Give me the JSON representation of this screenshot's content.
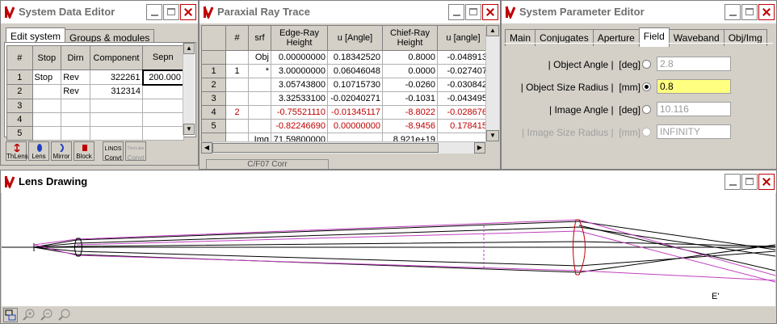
{
  "colors": {
    "accent_red": "#c00000",
    "highlight_yellow": "#ffff80",
    "ray_purple": "#c040c0",
    "lens_red": "#c00000"
  },
  "system_data_editor": {
    "title": "System Data Editor",
    "tabs": [
      {
        "label": "Edit system",
        "active": true
      },
      {
        "label": "Groups & modules",
        "active": false
      }
    ],
    "table": {
      "headers": [
        "#",
        "Stop",
        "Dirn",
        "Component",
        "Sepn"
      ],
      "rows": [
        {
          "num": "1",
          "stop": "Stop",
          "dirn": "Rev",
          "component": "322261",
          "sepn": "200.000"
        },
        {
          "num": "2",
          "stop": "",
          "dirn": "Rev",
          "component": "312314",
          "sepn": ""
        },
        {
          "num": "3",
          "stop": "",
          "dirn": "",
          "component": "",
          "sepn": ""
        },
        {
          "num": "4",
          "stop": "",
          "dirn": "",
          "component": "",
          "sepn": ""
        },
        {
          "num": "5",
          "stop": "",
          "dirn": "",
          "component": "",
          "sepn": ""
        }
      ]
    },
    "toolbar": [
      {
        "label": "ThLens",
        "icon": "thick-lens-icon",
        "enabled": true
      },
      {
        "label": "Lens",
        "icon": "lens-icon",
        "enabled": true
      },
      {
        "label": "Mirror",
        "icon": "mirror-icon",
        "enabled": true
      },
      {
        "label": "Block",
        "icon": "block-icon",
        "enabled": true
      },
      {
        "label": "Convt",
        "sublabel": "LINOS",
        "icon": "convert-linos-icon",
        "enabled": true
      },
      {
        "label": "Convt",
        "sublabel": "ThorLabs",
        "icon": "convert-thorlabs-icon",
        "enabled": false
      }
    ]
  },
  "paraxial_ray_trace": {
    "title": "Paraxial Ray Trace",
    "headers": [
      "#",
      "srf",
      "Edge-Ray Height",
      "u [Angle]",
      "Chief-Ray Height",
      "u [angle]"
    ],
    "rows": [
      {
        "num": "",
        "grp": "",
        "srf": "Obj",
        "edge_h": "0.00000000",
        "u1": "0.18342520",
        "chief_h": "0.8000",
        "u2": "-0.048913",
        "red": false
      },
      {
        "num": "1",
        "grp": "1",
        "srf": "*",
        "edge_h": "3.00000000",
        "u1": "0.06046048",
        "chief_h": "0.0000",
        "u2": "-0.027407",
        "red": false
      },
      {
        "num": "2",
        "grp": "",
        "srf": "",
        "edge_h": "3.05743800",
        "u1": "0.10715730",
        "chief_h": "-0.0260",
        "u2": "-0.030842",
        "red": false
      },
      {
        "num": "3",
        "grp": "",
        "srf": "",
        "edge_h": "3.32533100",
        "u1": "-0.02040271",
        "chief_h": "-0.1031",
        "u2": "-0.043495",
        "red": false
      },
      {
        "num": "4",
        "grp": "2",
        "srf": "",
        "edge_h": "-0.75521110",
        "u1": "-0.01345117",
        "chief_h": "-8.8022",
        "u2": "-0.028676",
        "red": true
      },
      {
        "num": "5",
        "grp": "",
        "srf": "",
        "edge_h": "-0.82246690",
        "u1": "0.00000000",
        "chief_h": "-8.9456",
        "u2": "0.178415",
        "red": true
      },
      {
        "num": "",
        "grp": "",
        "srf": "Img",
        "edge_h": "71.59800000",
        "u1": "",
        "chief_h": "8.921e+19",
        "u2": "",
        "red": false
      }
    ],
    "status": "C/F07 Corr"
  },
  "system_parameter_editor": {
    "title": "System Parameter Editor",
    "tabs": [
      {
        "label": "Main",
        "active": false
      },
      {
        "label": "Conjugates",
        "active": false
      },
      {
        "label": "Aperture",
        "active": false
      },
      {
        "label": "Field",
        "active": true
      },
      {
        "label": "Waveband",
        "active": false
      },
      {
        "label": "Obj/Img",
        "active": false
      }
    ],
    "params": [
      {
        "label": "| Object Angle |",
        "unit": "[deg]",
        "value": "2.8",
        "selected": false,
        "enabled": true
      },
      {
        "label": "| Object Size Radius |",
        "unit": "[mm]",
        "value": "0.8",
        "selected": true,
        "enabled": true
      },
      {
        "label": "| Image Angle |",
        "unit": "[deg]",
        "value": "10.116",
        "selected": false,
        "enabled": true
      },
      {
        "label": "| Image Size Radius |",
        "unit": "[mm]",
        "value": "INFINITY",
        "selected": false,
        "enabled": false
      }
    ]
  },
  "lens_drawing": {
    "title": "Lens Drawing",
    "label": "E'",
    "toolbar": [
      {
        "icon": "layout-icon"
      },
      {
        "icon": "zoom-in-icon"
      },
      {
        "icon": "zoom-out-icon"
      },
      {
        "icon": "zoom-fit-icon"
      }
    ]
  }
}
